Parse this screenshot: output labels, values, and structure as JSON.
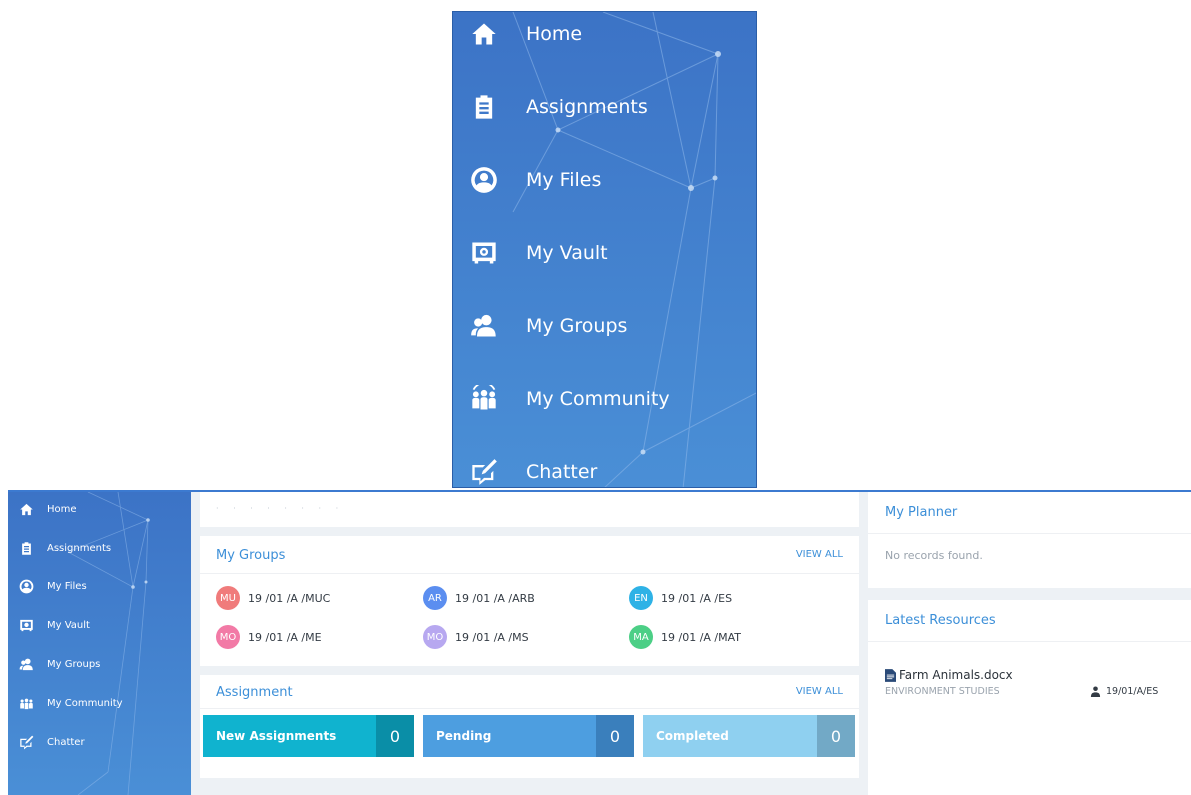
{
  "sidebar": {
    "items": [
      {
        "label": "Home",
        "icon": "home-icon"
      },
      {
        "label": "Assignments",
        "icon": "clipboard-icon"
      },
      {
        "label": "My Files",
        "icon": "user-circle-icon"
      },
      {
        "label": "My Vault",
        "icon": "vault-icon"
      },
      {
        "label": "My Groups",
        "icon": "group-icon"
      },
      {
        "label": "My Community",
        "icon": "community-icon"
      },
      {
        "label": "Chatter",
        "icon": "chat-edit-icon"
      }
    ]
  },
  "my_groups": {
    "title": "My Groups",
    "view_all": "VIEW ALL",
    "groups": [
      {
        "abbr": "MU",
        "name": "19 /01 /A /MUC",
        "color": "#f07b7b"
      },
      {
        "abbr": "AR",
        "name": "19 /01 /A /ARB",
        "color": "#5b8ef0"
      },
      {
        "abbr": "EN",
        "name": "19 /01 /A /ES",
        "color": "#2eb2e6"
      },
      {
        "abbr": "MO",
        "name": "19 /01 /A /ME",
        "color": "#f27aa6"
      },
      {
        "abbr": "MO",
        "name": "19 /01 /A /MS",
        "color": "#b7a8f0"
      },
      {
        "abbr": "MA",
        "name": "19 /01 /A /MAT",
        "color": "#4ccf86"
      }
    ]
  },
  "assignment": {
    "title": "Assignment",
    "view_all": "VIEW ALL",
    "stats": [
      {
        "label": "New Assignments",
        "count": "0",
        "color": "#10b3cf",
        "count_color": "#0a8ea7"
      },
      {
        "label": "Pending",
        "count": "0",
        "color": "#4d9ee0",
        "count_color": "#3a7fbc"
      },
      {
        "label": "Completed",
        "count": "0",
        "color": "#8fd0f0",
        "count_color": "#72a9c6"
      }
    ]
  },
  "planner": {
    "title": "My Planner",
    "empty": "No records found."
  },
  "resources": {
    "title": "Latest Resources",
    "items": [
      {
        "file": "Farm Animals.docx",
        "subject": "ENVIRONMENT STUDIES",
        "group": "19/01/A/ES"
      }
    ]
  },
  "colors": {
    "sidebar_top": "#3c73c6",
    "sidebar_bottom": "#4a8fd6",
    "accent": "#3c8fd8"
  }
}
